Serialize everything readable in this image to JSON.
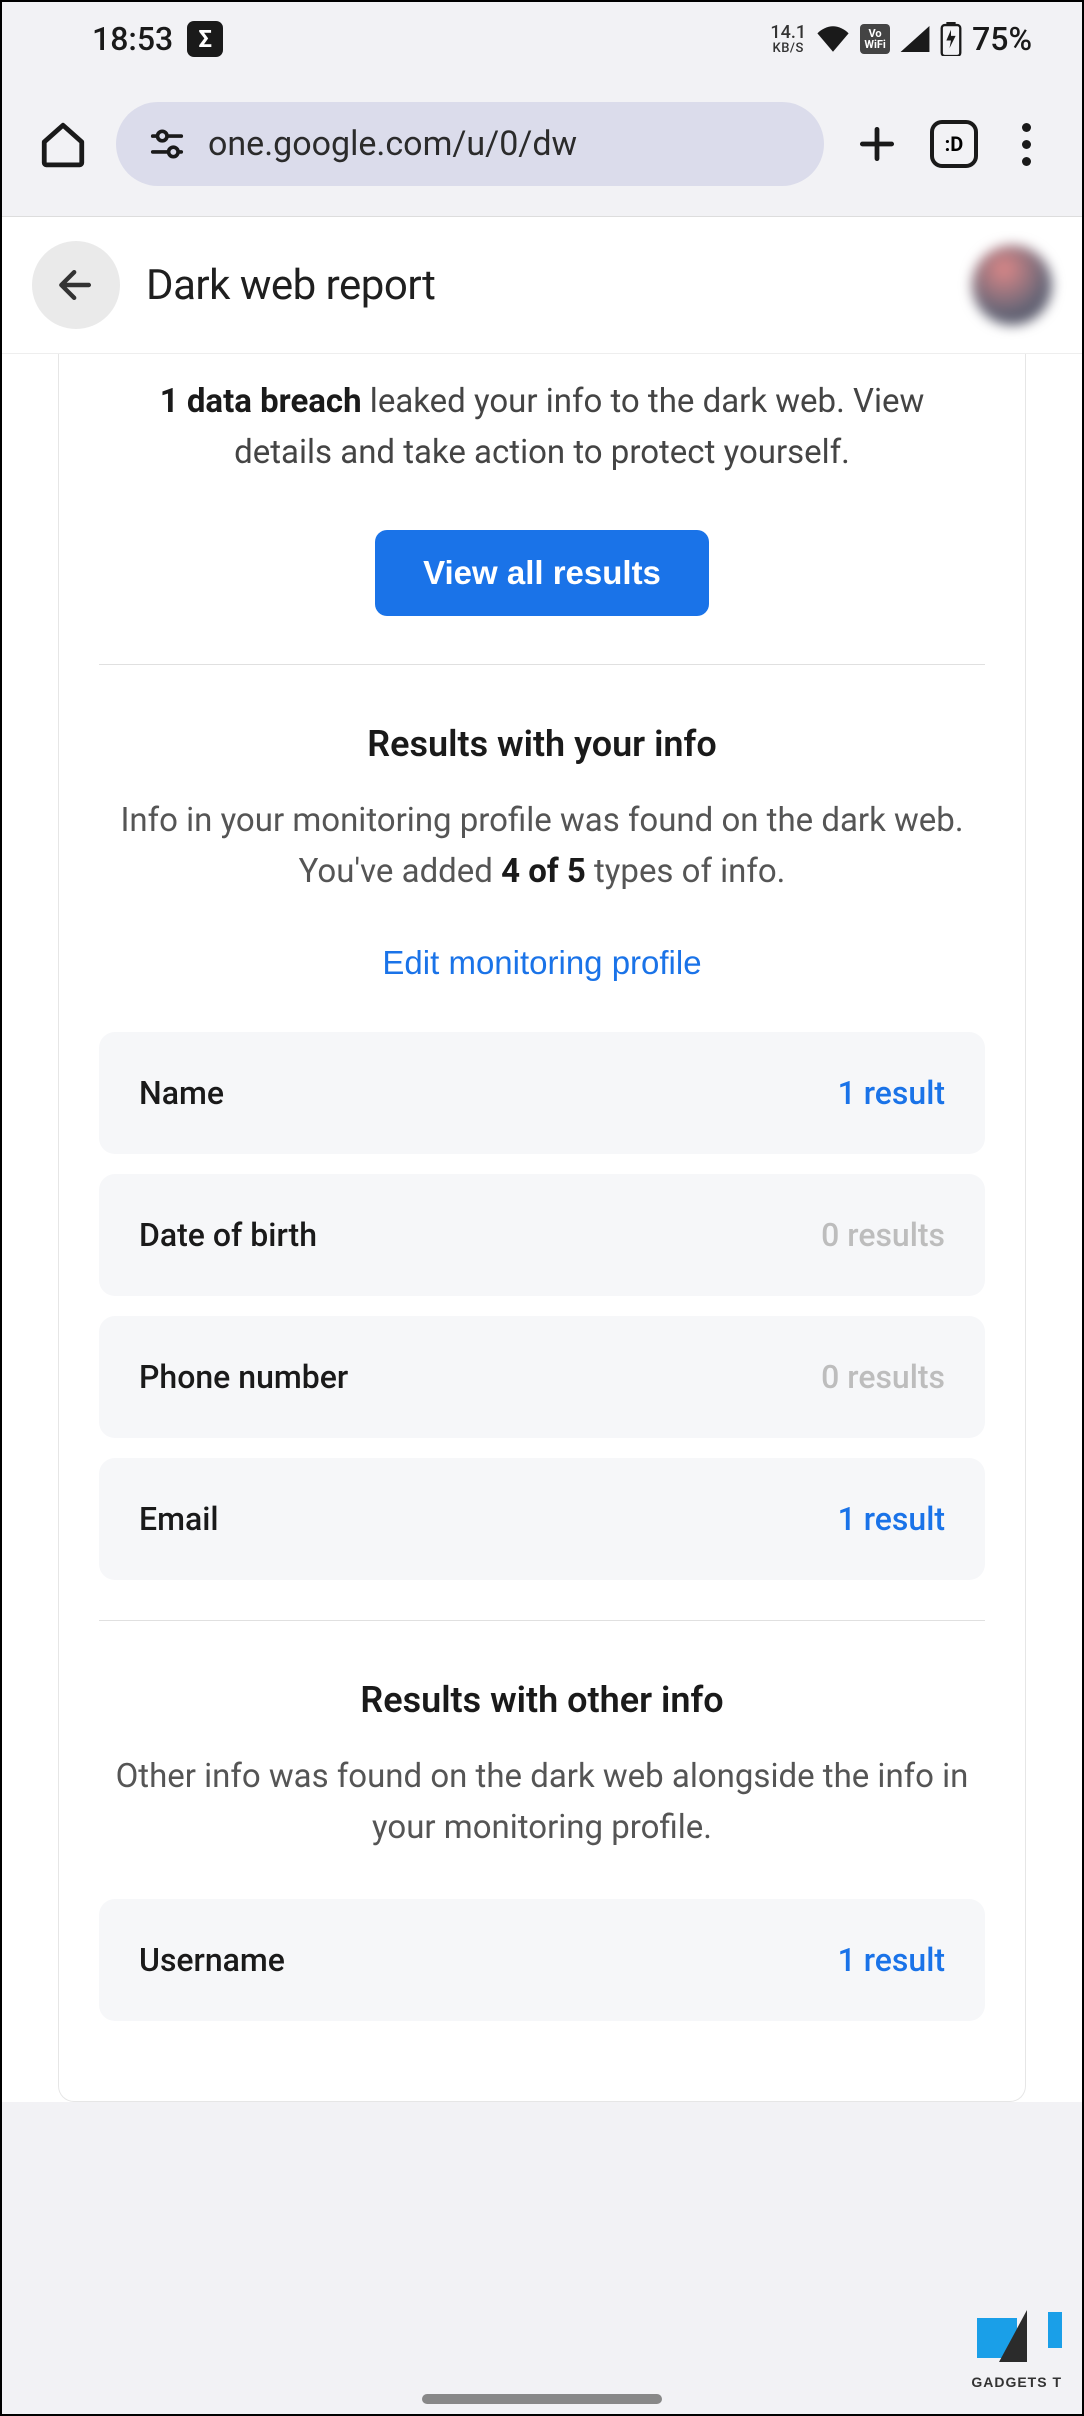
{
  "status": {
    "time": "18:53",
    "kb_rate_num": "14.1",
    "kb_rate_unit": "KB/S",
    "vo_top": "Vo",
    "vo_bottom": "WiFi",
    "battery": "75%"
  },
  "browser": {
    "url": "one.google.com/u/0/dw",
    "tabs_label": ":D"
  },
  "header": {
    "title": "Dark web report"
  },
  "breach": {
    "bold": "1 data breach",
    "rest": " leaked your info to the dark web. View details and take action to protect yourself.",
    "button": "View all results"
  },
  "results_your": {
    "title": "Results with your info",
    "desc_pre": "Info in your monitoring profile was found on the dark web. You've added ",
    "desc_bold": "4 of 5",
    "desc_post": " types of info.",
    "edit_link": "Edit monitoring profile",
    "rows": [
      {
        "label": "Name",
        "count": "1 result",
        "zero": false
      },
      {
        "label": "Date of birth",
        "count": "0 results",
        "zero": true
      },
      {
        "label": "Phone number",
        "count": "0 results",
        "zero": true
      },
      {
        "label": "Email",
        "count": "1 result",
        "zero": false
      }
    ]
  },
  "results_other": {
    "title": "Results with other info",
    "desc": "Other info was found on the dark web alongside the info in your monitoring profile.",
    "rows": [
      {
        "label": "Username",
        "count": "1 result",
        "zero": false
      }
    ]
  },
  "watermark": "GADGETS T"
}
